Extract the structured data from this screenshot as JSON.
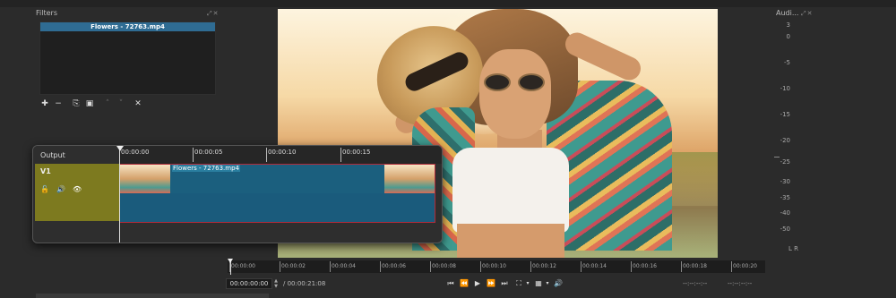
{
  "filters": {
    "title": "Filters",
    "controls": "⤢✕",
    "item": "Flowers - 72763.mp4",
    "toolbar": [
      {
        "name": "add-filter-button",
        "glyph": "✚"
      },
      {
        "name": "remove-filter-button",
        "glyph": "−"
      },
      {
        "name": "copy-filter-button",
        "glyph": "⎘"
      },
      {
        "name": "paste-filter-button",
        "glyph": "▣"
      },
      {
        "name": "move-up-button",
        "glyph": "˄"
      },
      {
        "name": "move-down-button",
        "glyph": "˅"
      },
      {
        "name": "deselect-filter-button",
        "glyph": "✕"
      }
    ]
  },
  "audio": {
    "title": "Audi...",
    "controls": "⤢✕",
    "scale": [
      "3",
      "0",
      "-5",
      "-10",
      "-15",
      "-20",
      "-25",
      "-30",
      "-35",
      "-40",
      "-50"
    ],
    "channels": "L R"
  },
  "timeline": {
    "output_label": "Output",
    "ticks": [
      "00:00:00",
      "00:00:05",
      "00:00:10",
      "00:00:15"
    ],
    "track": {
      "name": "V1",
      "icons": [
        "lock-icon",
        "audio-icon",
        "eye-icon"
      ]
    },
    "clip_label": "Flowers - 72763.mp4"
  },
  "scrubber": {
    "ticks": [
      "00:00:00",
      "00:00:02",
      "00:00:04",
      "00:00:06",
      "00:00:08",
      "00:00:10",
      "00:00:12",
      "00:00:14",
      "00:00:16",
      "00:00:18",
      "00:00:20"
    ]
  },
  "transport": {
    "timecode": "00:00:00:00",
    "duration": "/ 00:00:21:08",
    "in_point": "--:--:--:--",
    "out_point": "--:--:--:--"
  }
}
